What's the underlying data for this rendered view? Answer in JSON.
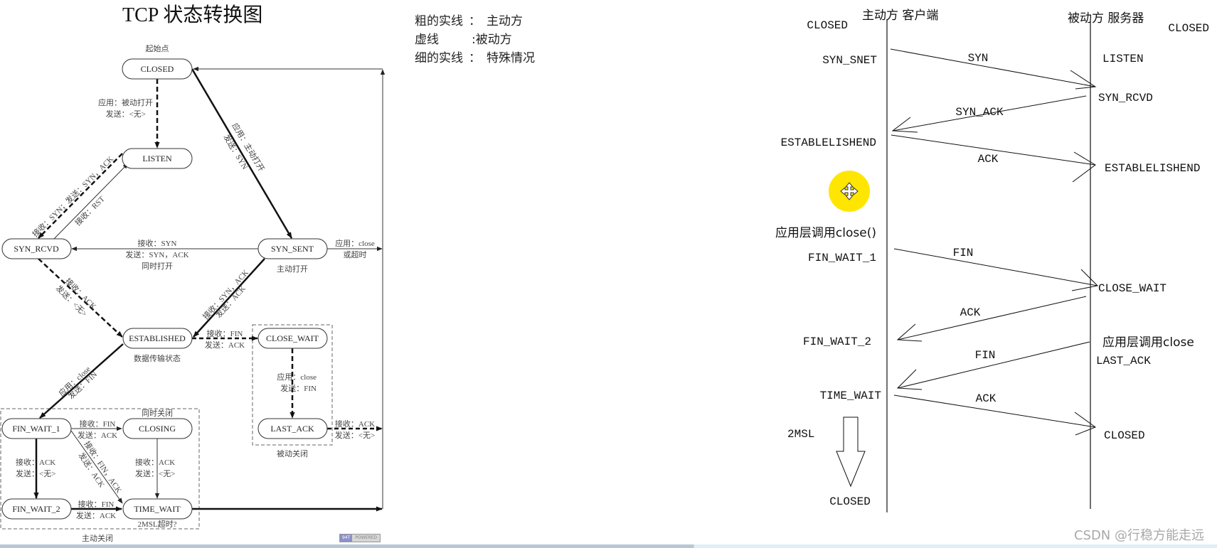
{
  "title": "TCP 状态转换图",
  "legend": [
    {
      "line": "粗的实线",
      "sep": "：",
      "meaning": "主动方"
    },
    {
      "line": "虚线",
      "sep": ":",
      "meaning": "被动方"
    },
    {
      "line": "细的实线",
      "sep": "：",
      "meaning": "特殊情况"
    }
  ],
  "state_diagram": {
    "nodes": {
      "closed": "CLOSED",
      "listen": "LISTEN",
      "syn_rcvd": "SYN_RCVD",
      "syn_sent": "SYN_SENT",
      "established": "ESTABLISHED",
      "close_wait": "CLOSE_WAIT",
      "last_ack": "LAST_ACK",
      "fin_wait_1": "FIN_WAIT_1",
      "closing": "CLOSING",
      "fin_wait_2": "FIN_WAIT_2",
      "time_wait": "TIME_WAIT"
    },
    "annotations": {
      "start_point": "起始点",
      "active_open": "主动打开",
      "data_transfer": "数据传输状态",
      "passive_close": "被动关闭",
      "simultaneous_close": "同时关闭",
      "active_close": "主动关闭",
      "msl_timeout": "2MSL超时?"
    },
    "edges": {
      "closed_listen": [
        "应用：被动打开",
        "发送：<无>"
      ],
      "closed_synsent": [
        "应用：主动打开",
        "发送：SYN"
      ],
      "listen_synrcvd": "接收：SYN；发送：SYN，ACK",
      "synrcvd_listen": "接收：RST",
      "synsent_synrcvd": [
        "接收：SYN",
        "发送：SYN，ACK",
        "同时打开"
      ],
      "synsent_closed": [
        "应用：close",
        "或超时"
      ],
      "synrcvd_established": [
        "接收：ACK",
        "发送：<无>"
      ],
      "synsent_established": [
        "接收：SYN，ACK",
        "发送：ACK"
      ],
      "established_closewait": [
        "接收：FIN",
        "发送：ACK"
      ],
      "closewait_lastack": [
        "应用：close",
        "发送：FIN"
      ],
      "lastack_closed": [
        "接收：ACK",
        "发送：<无>"
      ],
      "established_finwait1": [
        "应用：close",
        "发送：FIN"
      ],
      "finwait1_closing": [
        "接收：FIN",
        "发送：ACK"
      ],
      "finwait1_finwait2": [
        "接收：ACK",
        "发送：<无>"
      ],
      "finwait1_timewait": [
        "接收：FIN，ACK",
        "发送：ACK"
      ],
      "closing_timewait": [
        "接收：ACK",
        "发送：<无>"
      ],
      "finwait2_timewait": [
        "接收：FIN",
        "发送：ACK"
      ]
    }
  },
  "sequence_diagram": {
    "client_header": "主动方 客户端",
    "server_header": "被动方 服务器",
    "client_states": {
      "closed_top": "CLOSED",
      "syn_sent": "SYN_SNET",
      "established": "ESTABLELISHEND",
      "app_close": "应用层调用close()",
      "fin_wait_1": "FIN_WAIT_1",
      "fin_wait_2": "FIN_WAIT_2",
      "time_wait": "TIME_WAIT",
      "msl": "2MSL",
      "closed_bottom": "CLOSED"
    },
    "server_states": {
      "closed_top": "CLOSED",
      "listen": "LISTEN",
      "syn_rcvd": "SYN_RCVD",
      "established": "ESTABLELISHEND",
      "close_wait": "CLOSE_WAIT",
      "app_close": "应用层调用close",
      "last_ack": "LAST_ACK",
      "closed": "CLOSED"
    },
    "messages": [
      "SYN",
      "SYN_ACK",
      "ACK",
      "FIN",
      "ACK",
      "FIN",
      "ACK"
    ]
  },
  "badge": {
    "left": "94T",
    "right": "POWERED"
  },
  "watermark": "CSDN @行稳方能走远",
  "cursor_highlight": {
    "icon": "move-cursor-icon",
    "color": "#ffe600"
  }
}
